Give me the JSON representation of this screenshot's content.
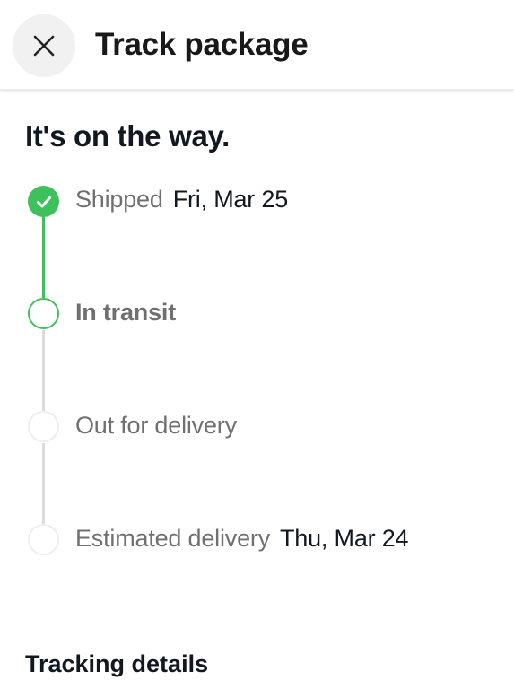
{
  "header": {
    "title": "Track package",
    "close_icon": "close-icon"
  },
  "status": {
    "heading": "It's on the way."
  },
  "timeline": {
    "accent_color": "#3ec15c",
    "steps": [
      {
        "label": "Shipped",
        "date": "Fri, Mar 25",
        "state": "complete"
      },
      {
        "label": "In transit",
        "date": "",
        "state": "current"
      },
      {
        "label": "Out for delivery",
        "date": "",
        "state": "upcoming"
      },
      {
        "label": "Estimated delivery",
        "date": "Thu, Mar 24",
        "state": "upcoming"
      }
    ]
  },
  "tracking": {
    "section_title": "Tracking details"
  }
}
